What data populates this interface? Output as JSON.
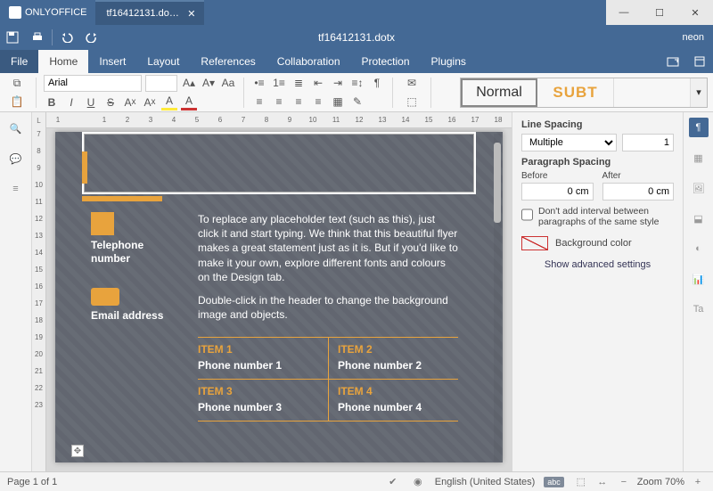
{
  "app": {
    "name": "ONLYOFFICE",
    "tab_title": "tf16412131.do…",
    "doc_title": "tf16412131.dotx",
    "user": "neon"
  },
  "menu": {
    "file": "File",
    "home": "Home",
    "insert": "Insert",
    "layout": "Layout",
    "references": "References",
    "collaboration": "Collaboration",
    "protection": "Protection",
    "plugins": "Plugins"
  },
  "ribbon": {
    "font_name": "Arial",
    "font_size": "",
    "styles": {
      "normal": "Normal",
      "subtitle": "SUBT",
      "blank": ""
    }
  },
  "settings": {
    "line_spacing_label": "Line Spacing",
    "line_spacing_mode": "Multiple",
    "line_spacing_value": "1",
    "para_label": "Paragraph Spacing",
    "before_label": "Before",
    "after_label": "After",
    "before_value": "0 cm",
    "after_value": "0 cm",
    "chk_label": "Don't add interval between paragraphs of the same style",
    "bg_label": "Background color",
    "adv_label": "Show advanced settings"
  },
  "doc": {
    "tel_label1": "Telephone",
    "tel_label2": "number",
    "mail_label1": "Email",
    "mail_label2": "address",
    "para1": "To replace any placeholder text (such as this), just click it and start typing. We think that this beautiful flyer makes a great statement just as it is. But if you'd like to make it your own, explore different fonts and colours on the Design tab.",
    "para2": "Double-click in the header to change the background image and objects.",
    "items": [
      {
        "head": "ITEM 1",
        "text": "Phone number 1"
      },
      {
        "head": "ITEM 2",
        "text": "Phone number 2"
      },
      {
        "head": "ITEM 3",
        "text": "Phone number 3"
      },
      {
        "head": "ITEM 4",
        "text": "Phone number 4"
      }
    ]
  },
  "status": {
    "page": "Page 1 of 1",
    "lang": "English (United States)",
    "zoom": "Zoom 70%"
  },
  "ruler_h": [
    "1",
    "",
    "1",
    "2",
    "3",
    "4",
    "5",
    "6",
    "7",
    "8",
    "9",
    "10",
    "11",
    "12",
    "13",
    "14",
    "15",
    "16",
    "17",
    "18"
  ],
  "ruler_v": [
    "7",
    "8",
    "9",
    "10",
    "11",
    "12",
    "13",
    "14",
    "15",
    "16",
    "17",
    "18",
    "19",
    "20",
    "21",
    "22",
    "23"
  ]
}
